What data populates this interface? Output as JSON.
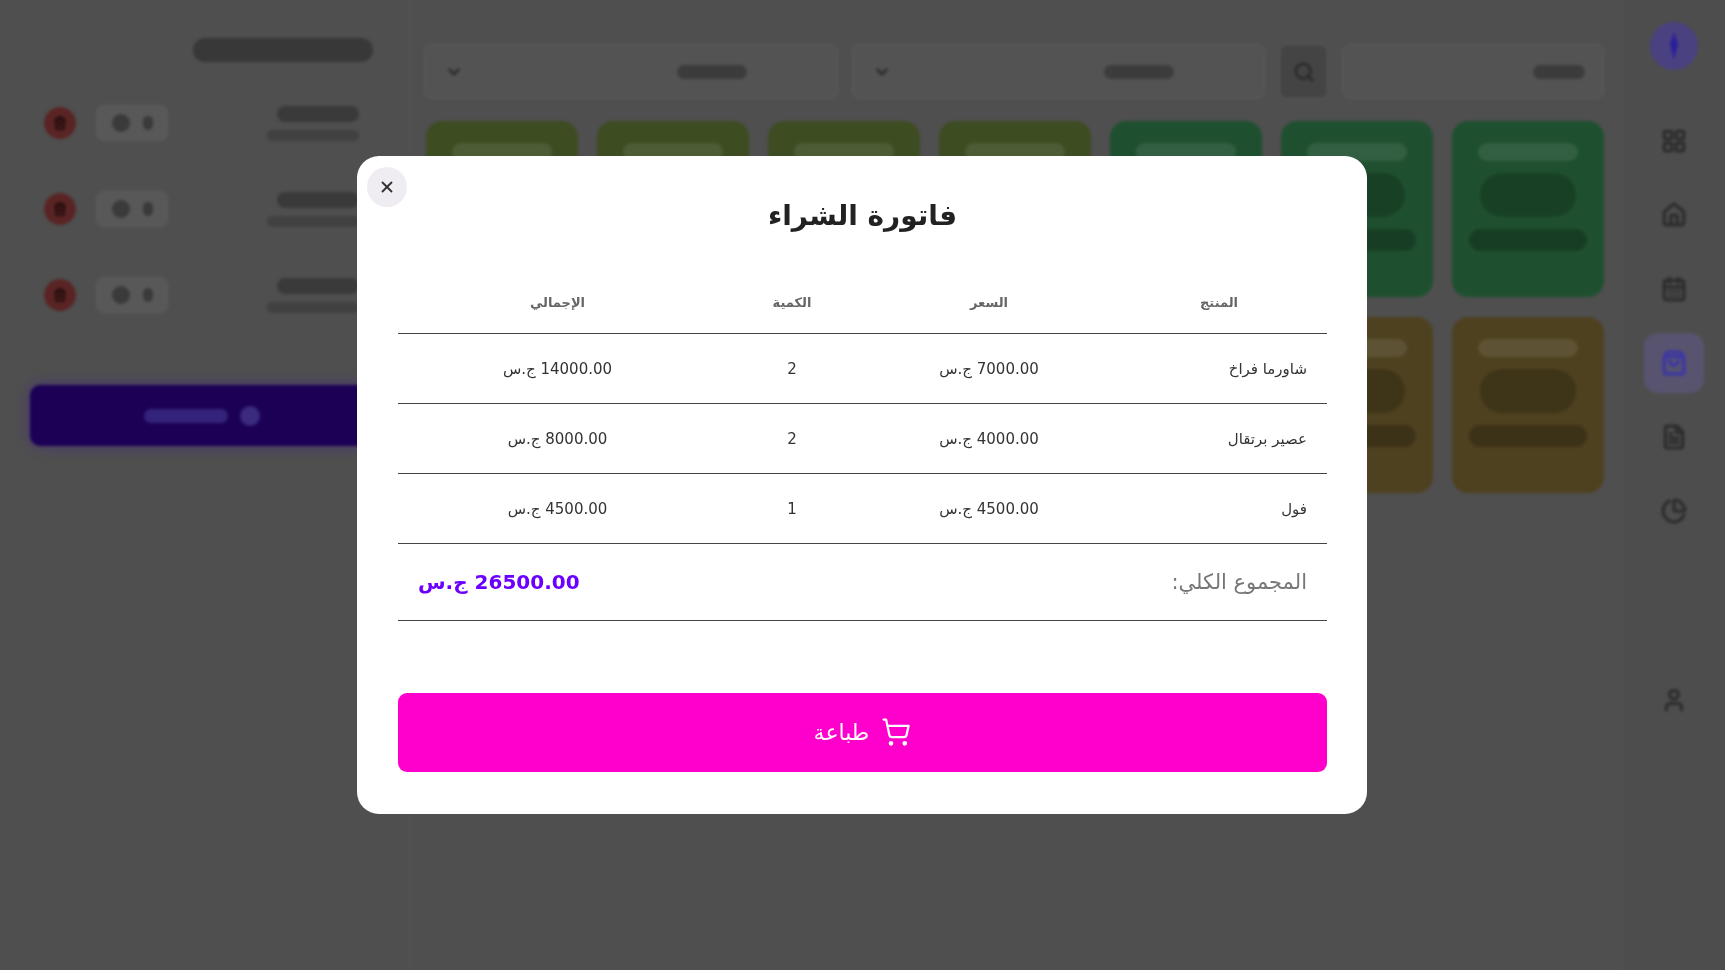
{
  "sidebar": {
    "nav_items": [
      {
        "selected": false
      },
      {
        "selected": false
      },
      {
        "selected": false
      },
      {
        "selected": true
      },
      {
        "selected": false
      },
      {
        "selected": false
      }
    ]
  },
  "search_bar": {
    "fields": [
      {
        "kind": "text_input"
      },
      {
        "kind": "search_button"
      },
      {
        "kind": "dropdown"
      },
      {
        "kind": "dropdown"
      }
    ]
  },
  "product_cards": [
    {
      "color": "#1e502f"
    },
    {
      "color": "#1e502f"
    },
    {
      "color": "#1e502f"
    },
    {
      "color": "#3d4c21"
    },
    {
      "color": "#3d4c21"
    },
    {
      "color": "#3d4c21"
    },
    {
      "color": "#3d4c21"
    },
    {
      "color": "#4e411f"
    },
    {
      "color": "#4e411f"
    }
  ],
  "cart": {
    "rows": [
      {
        "kind": "line_item"
      },
      {
        "kind": "line_item"
      },
      {
        "kind": "line_item"
      }
    ]
  },
  "invoice_dialog": {
    "title": "فاتورة الشراء",
    "table": {
      "columns": [
        "المنتج",
        "السعر",
        "الكمية",
        "الإجمالي"
      ],
      "rows": [
        {
          "product": "شاورما فراخ",
          "price": "7000.00 ج.س",
          "quantity": "2",
          "total": "14000.00 ج.س"
        },
        {
          "product": "عصير برتقال",
          "price": "4000.00 ج.س",
          "quantity": "2",
          "total": "8000.00 ج.س"
        },
        {
          "product": "فول",
          "price": "4500.00 ج.س",
          "quantity": "1",
          "total": "4500.00 ج.س"
        }
      ]
    },
    "grand_total": {
      "label": "المجموع الكلي:",
      "value": "26500.00 ج.س"
    },
    "print_button": {
      "label": "طباعة"
    }
  }
}
